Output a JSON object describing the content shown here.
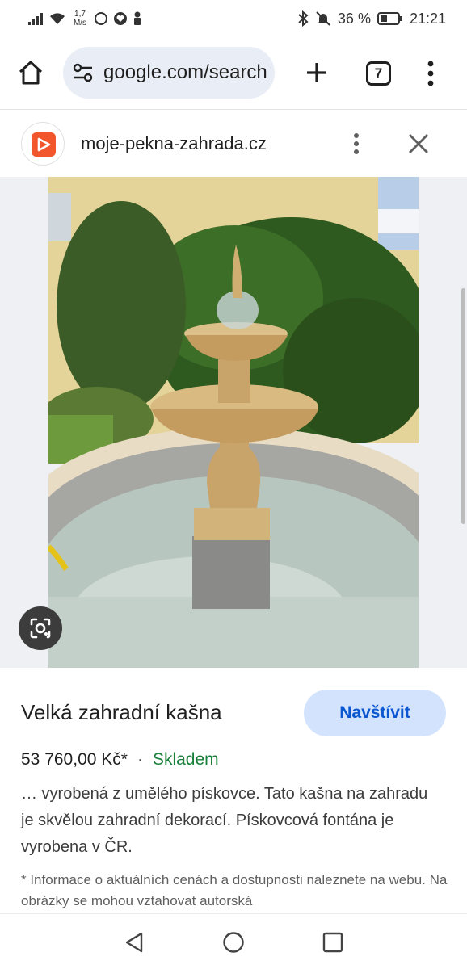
{
  "status_bar": {
    "net_speed_value": "1,7",
    "net_speed_unit": "M/s",
    "battery_percent": "36 %",
    "time": "21:21"
  },
  "browser": {
    "url": "google.com/search",
    "tab_count": "7"
  },
  "site": {
    "name": "moje-pekna-zahrada.cz",
    "logo_color": "#f2562c"
  },
  "product": {
    "title": "Velká zahradní kašna",
    "visit_label": "Navštívit",
    "price": "53 760,00 Kč*",
    "separator": "·",
    "availability": "Skladem",
    "description": "… vyrobená z umělého pískovce. Tato kašna na zahradu je skvělou zahradní dekorací. Pískovcová fontána je vyrobena v ČR.",
    "note": "* Informace o aktuálních cenách a dostupnosti naleznete na webu. Na obrázky se mohou vztahovat autorská"
  },
  "colors": {
    "accent": "#0b57d0",
    "visit_bg": "#d3e3fd",
    "stock_green": "#188038",
    "omnibox_bg": "#e9eef6"
  },
  "icons": [
    "signal-icon",
    "wifi-icon",
    "whatsapp-icon",
    "heart-icon",
    "pawn-icon",
    "bluetooth-icon",
    "mute-icon",
    "battery-icon",
    "home-icon",
    "tune-icon",
    "plus-icon",
    "tabs-icon",
    "more-vert-icon",
    "close-icon",
    "lens-icon",
    "back-icon",
    "circle-home-icon",
    "square-recent-icon"
  ]
}
